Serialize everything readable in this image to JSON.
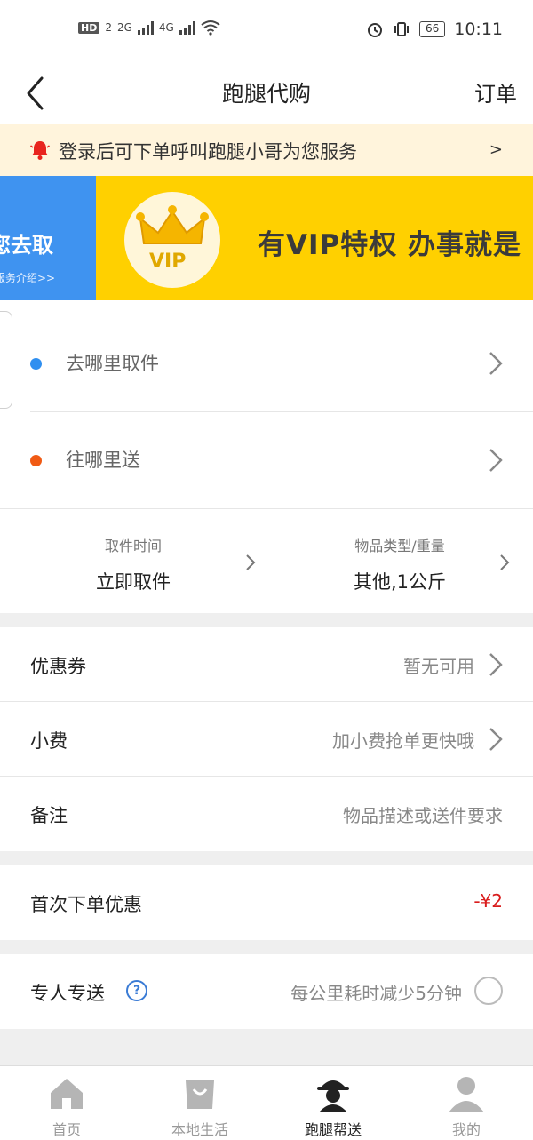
{
  "status_bar": {
    "network_badge": "HD",
    "network_sub": "2",
    "sig1": "2G",
    "sig2": "4G",
    "battery": "66",
    "time": "10:11"
  },
  "navbar": {
    "title": "跑腿代购",
    "orders_label": "订单"
  },
  "notice": {
    "text": "登录后可下单呼叫跑腿小哥为您服务",
    "arrow": ">"
  },
  "banner": {
    "left_title": "您去取",
    "left_link": "服务介绍>>",
    "vip_badge": "VIP",
    "slogan": "有VIP特权  办事就是"
  },
  "address": {
    "pickup_placeholder": "去哪里取件",
    "deliver_placeholder": "往哪里送",
    "pickup_dot_color": "#2f8ff0",
    "deliver_dot_color": "#f05a14"
  },
  "options": {
    "time_caption": "取件时间",
    "time_value": "立即取件",
    "goods_caption": "物品类型/重量",
    "goods_value": "其他,1公斤"
  },
  "form": {
    "coupon_label": "优惠券",
    "coupon_value": "暂无可用",
    "tip_label": "小费",
    "tip_value": "加小费抢单更快哦",
    "note_label": "备注",
    "note_placeholder": "物品描述或送件要求"
  },
  "discount": {
    "label": "首次下单优惠",
    "value": "-¥2"
  },
  "dedicated": {
    "label": "专人专送",
    "help_glyph": "?",
    "hint": "每公里耗时减少5分钟"
  },
  "tabbar": {
    "tabs": [
      {
        "label": "首页"
      },
      {
        "label": "本地生活"
      },
      {
        "label": "跑腿帮送"
      },
      {
        "label": "我的"
      }
    ],
    "active_index": 2
  }
}
